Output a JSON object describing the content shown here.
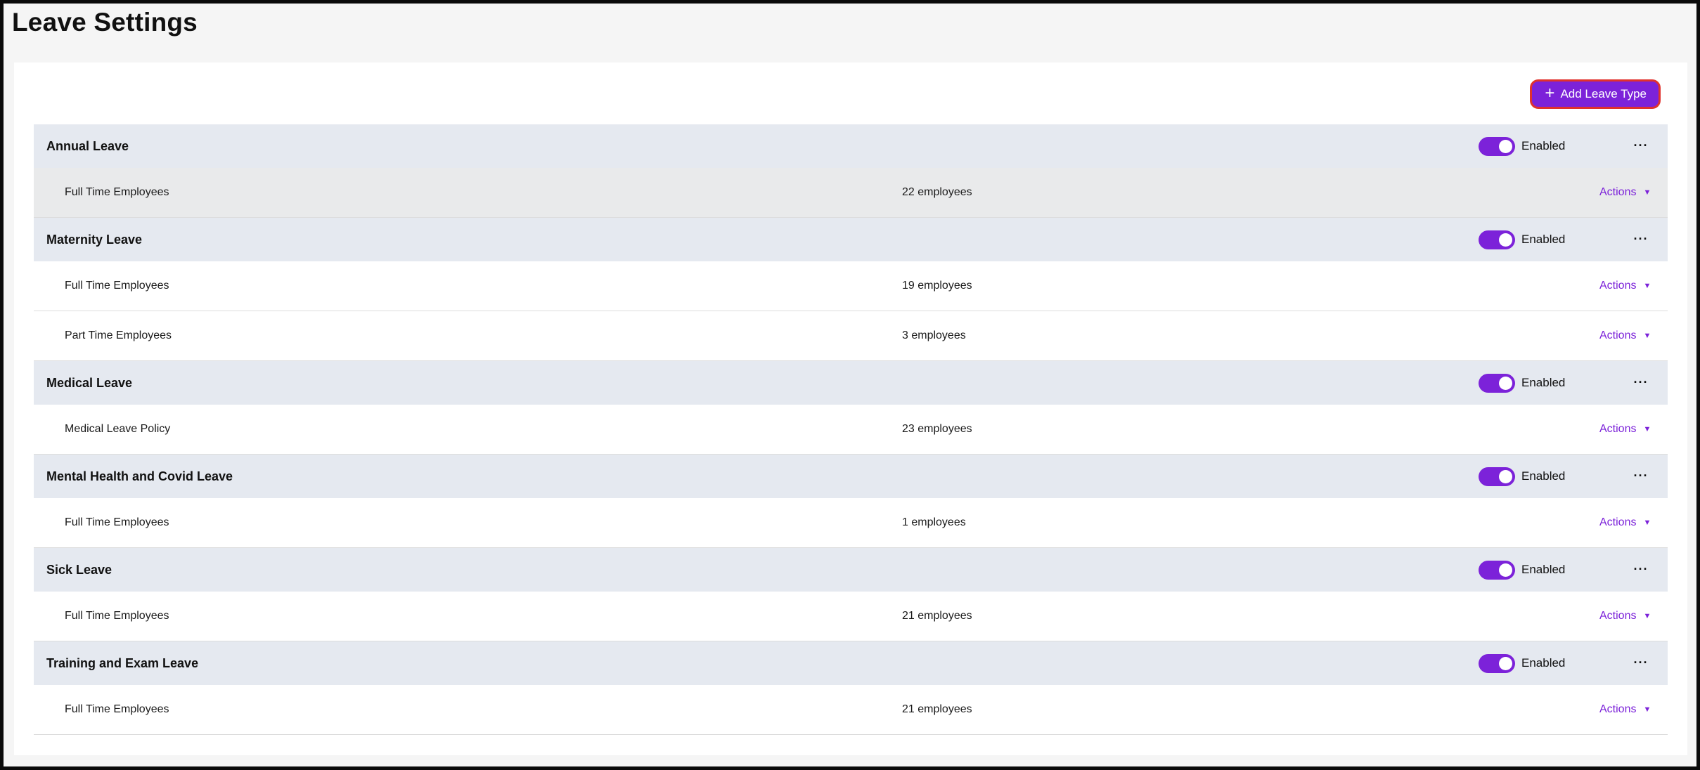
{
  "page": {
    "title": "Leave Settings"
  },
  "toolbar": {
    "add_label": "Add Leave Type",
    "add_icon": "plus-icon"
  },
  "colors": {
    "accent": "#7c22d9",
    "header_bg": "#e5e9f0",
    "focus_ring": "#e0322d"
  },
  "groups": [
    {
      "name": "Annual Leave",
      "status": "Enabled",
      "more": "···",
      "policies": [
        {
          "name": "Full Time Employees",
          "count": "22 employees",
          "actions": "Actions",
          "caret": "▼"
        }
      ]
    },
    {
      "name": "Maternity Leave",
      "status": "Enabled",
      "more": "···",
      "policies": [
        {
          "name": "Full Time Employees",
          "count": "19 employees",
          "actions": "Actions",
          "caret": "▼"
        },
        {
          "name": "Part Time Employees",
          "count": "3 employees",
          "actions": "Actions",
          "caret": "▼"
        }
      ]
    },
    {
      "name": "Medical Leave",
      "status": "Enabled",
      "more": "···",
      "policies": [
        {
          "name": "Medical Leave Policy",
          "count": "23 employees",
          "actions": "Actions",
          "caret": "▼"
        }
      ]
    },
    {
      "name": "Mental Health and Covid Leave",
      "status": "Enabled",
      "more": "···",
      "policies": [
        {
          "name": "Full Time Employees",
          "count": "1 employees",
          "actions": "Actions",
          "caret": "▼"
        }
      ]
    },
    {
      "name": "Sick Leave",
      "status": "Enabled",
      "more": "···",
      "policies": [
        {
          "name": "Full Time Employees",
          "count": "21 employees",
          "actions": "Actions",
          "caret": "▼"
        }
      ]
    },
    {
      "name": "Training and Exam Leave",
      "status": "Enabled",
      "more": "···",
      "policies": [
        {
          "name": "Full Time Employees",
          "count": "21 employees",
          "actions": "Actions",
          "caret": "▼"
        }
      ]
    }
  ]
}
